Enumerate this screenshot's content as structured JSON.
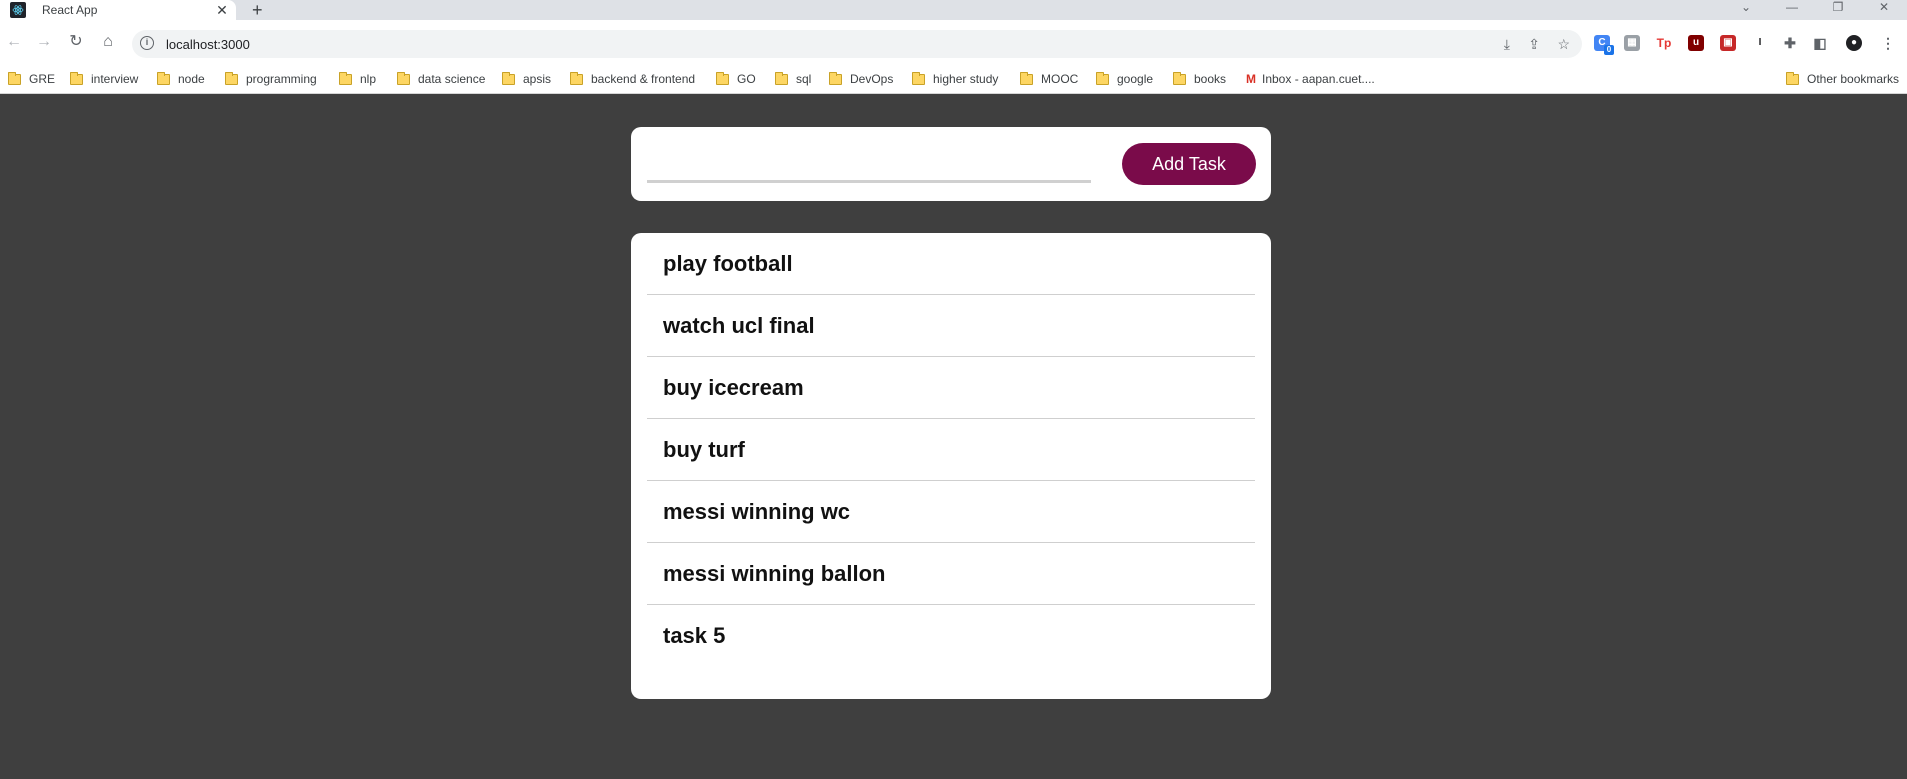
{
  "browser": {
    "tab_title": "React App",
    "url": "localhost:3000",
    "bookmarks": [
      "GRE",
      "interview",
      "node",
      "programming",
      "nlp",
      "data science",
      "apsis",
      "backend & frontend",
      "GO",
      "sql",
      "DevOps",
      "higher study",
      "MOOC",
      "google",
      "books",
      "Inbox - aapan.cuet...."
    ],
    "other_bookmarks": "Other bookmarks",
    "extension_badge": "0"
  },
  "form": {
    "input_value": "",
    "button_label": "Add Task"
  },
  "tasks": [
    "play football",
    "watch ucl final",
    "buy icecream",
    "buy turf",
    "messi winning wc",
    "messi winning ballon",
    "task 5"
  ],
  "colors": {
    "background": "#3f3f3f",
    "accent": "#7a0b4a",
    "card": "#ffffff"
  }
}
